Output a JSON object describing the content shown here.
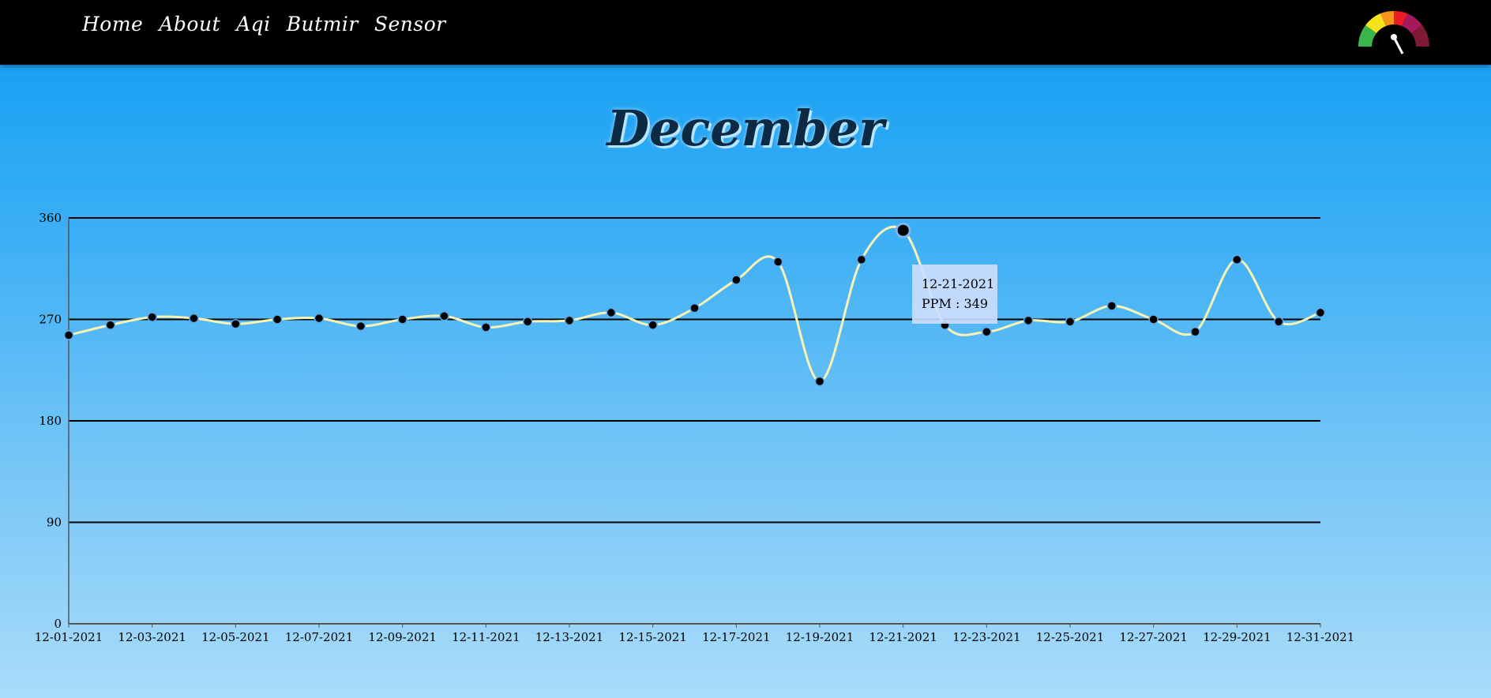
{
  "nav": {
    "items": [
      {
        "label": "Home"
      },
      {
        "label": "About"
      },
      {
        "label": "Aqi"
      },
      {
        "label": "Butmir"
      },
      {
        "label": "Sensor"
      }
    ]
  },
  "logo": {
    "icon": "aqi-gauge-icon"
  },
  "page": {
    "title": "December"
  },
  "tooltip": {
    "date": "12-21-2021",
    "text": "PPM : 349"
  },
  "colors": {
    "line": "#f7f3b4",
    "point": "#000000",
    "grid": "#000000"
  },
  "chart_data": {
    "type": "line",
    "title": "December",
    "xlabel": "",
    "ylabel": "",
    "ylim": [
      0,
      360
    ],
    "yticks": [
      0,
      90,
      180,
      270,
      360
    ],
    "grid": true,
    "x": [
      "12-01-2021",
      "12-02-2021",
      "12-03-2021",
      "12-04-2021",
      "12-05-2021",
      "12-06-2021",
      "12-07-2021",
      "12-08-2021",
      "12-09-2021",
      "12-10-2021",
      "12-11-2021",
      "12-12-2021",
      "12-13-2021",
      "12-14-2021",
      "12-15-2021",
      "12-16-2021",
      "12-17-2021",
      "12-18-2021",
      "12-19-2021",
      "12-20-2021",
      "12-21-2021",
      "12-22-2021",
      "12-23-2021",
      "12-24-2021",
      "12-25-2021",
      "12-26-2021",
      "12-27-2021",
      "12-28-2021",
      "12-29-2021",
      "12-30-2021",
      "12-31-2021"
    ],
    "xtick_labels": [
      "12-01-2021",
      "12-03-2021",
      "12-05-2021",
      "12-07-2021",
      "12-09-2021",
      "12-11-2021",
      "12-13-2021",
      "12-15-2021",
      "12-17-2021",
      "12-19-2021",
      "12-21-2021",
      "12-23-2021",
      "12-25-2021",
      "12-27-2021",
      "12-29-2021",
      "12-31-2021"
    ],
    "series": [
      {
        "values": [
          256,
          265,
          272,
          271,
          266,
          270,
          271,
          264,
          270,
          273,
          263,
          268,
          269,
          276,
          265,
          280,
          305,
          321,
          215,
          323,
          349,
          265,
          259,
          269,
          268,
          282,
          270,
          259,
          323,
          268,
          276
        ]
      }
    ],
    "highlight_index": 20
  }
}
